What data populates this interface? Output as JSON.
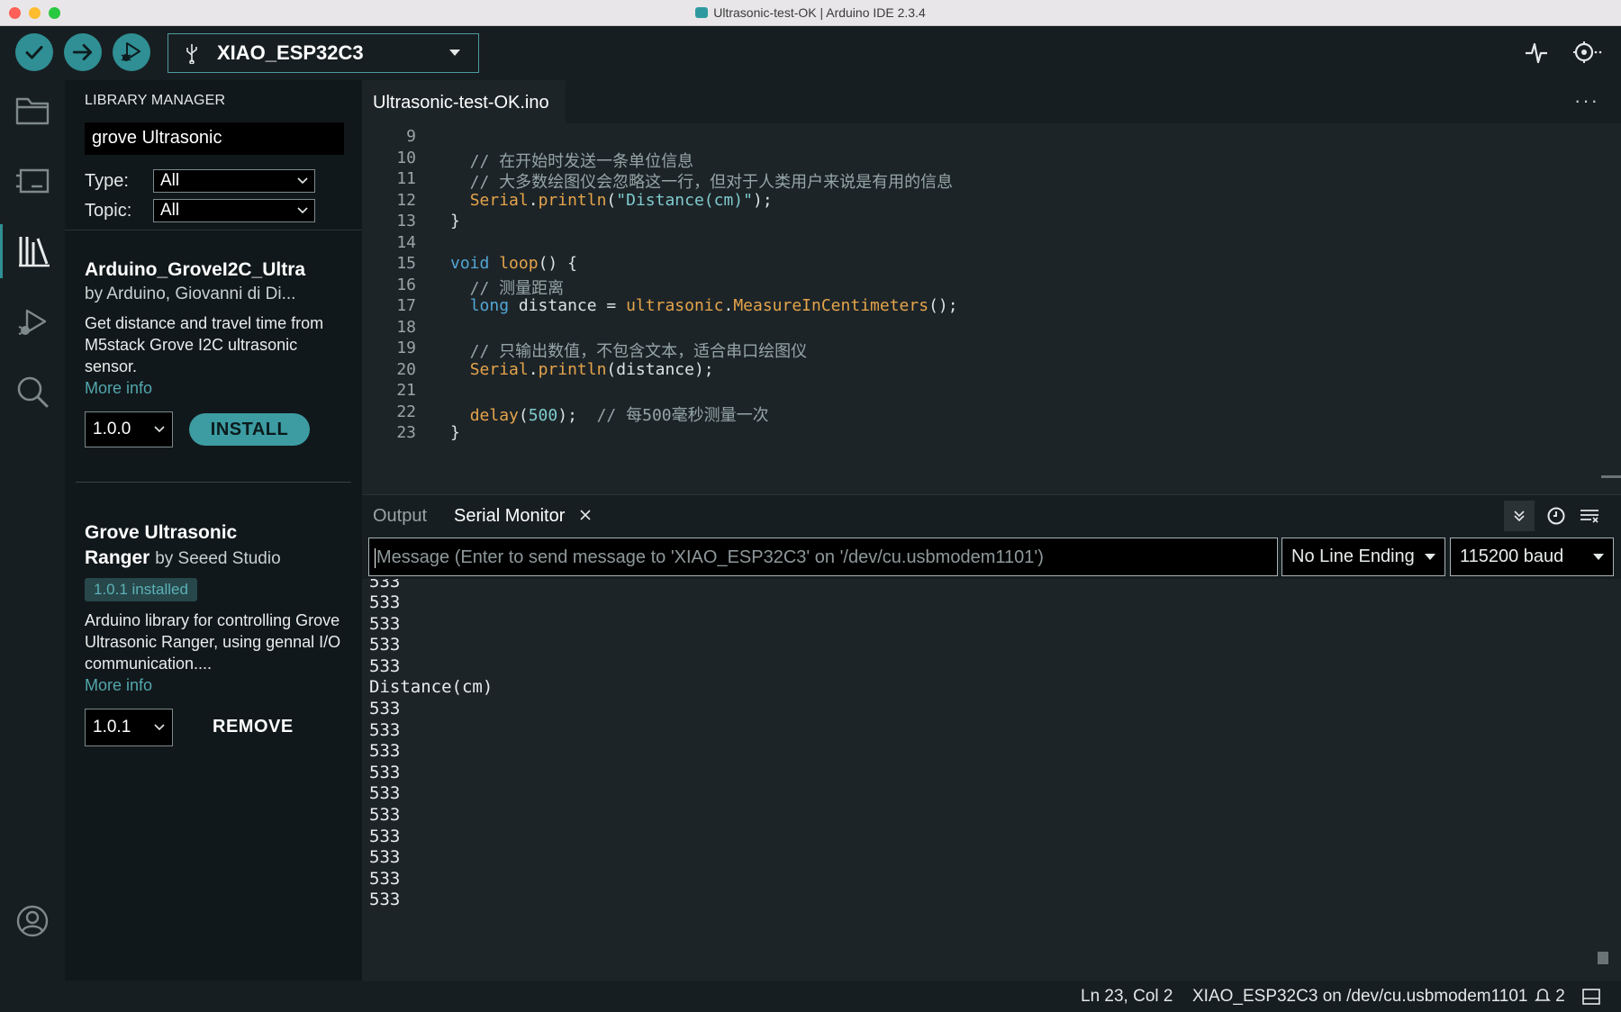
{
  "window": {
    "title": "Ultrasonic-test-OK | Arduino IDE 2.3.4"
  },
  "toolbar": {
    "verify_icon": "check-icon",
    "upload_icon": "arrow-right-icon",
    "debug_icon": "debug-play-icon",
    "board_name": "XIAO_ESP32C3",
    "serial_plotter_icon": "pulse-icon",
    "serial_monitor_icon": "serial-monitor-icon"
  },
  "activity_bar": [
    "folder-icon",
    "board-manager-icon",
    "library-icon",
    "debug-icon",
    "search-icon",
    "account-icon"
  ],
  "library_manager": {
    "title": "LIBRARY MANAGER",
    "search_value": "grove Ultrasonic",
    "type_label": "Type:",
    "type_value": "All",
    "topic_label": "Topic:",
    "topic_value": "All",
    "items": [
      {
        "name": "Arduino_GroveI2C_Ultra",
        "author": "by Arduino, Giovanni di Di...",
        "description": "Get distance and travel time from M5stack Grove I2C ultrasonic sensor.",
        "more_info": "More info",
        "version": "1.0.0",
        "action": "INSTALL"
      },
      {
        "name_line1": "Grove Ultrasonic",
        "name_line2": "Ranger",
        "author": "by Seeed Studio",
        "installed_badge": "1.0.1 installed",
        "description": "Arduino library for controlling Grove Ultrasonic Ranger, using gennal I/O communication....",
        "more_info": "More info",
        "version": "1.0.1",
        "action": "REMOVE"
      }
    ]
  },
  "editor": {
    "tab_name": "Ultrasonic-test-OK.ino",
    "more_label": "···",
    "lines": [
      {
        "n": "9",
        "parts": []
      },
      {
        "n": "10",
        "parts": [
          {
            "t": "  // 在开始时发送一条单位信息",
            "c": "c-comment"
          }
        ]
      },
      {
        "n": "11",
        "parts": [
          {
            "t": "  // 大多数绘图仪会忽略这一行，但对于人类用户来说是有用的信息",
            "c": "c-comment"
          }
        ]
      },
      {
        "n": "12",
        "parts": [
          {
            "t": "  ",
            "c": ""
          },
          {
            "t": "Serial",
            "c": "c-fn"
          },
          {
            "t": ".",
            "c": ""
          },
          {
            "t": "println",
            "c": "c-fn"
          },
          {
            "t": "(",
            "c": ""
          },
          {
            "t": "\"Distance(cm)\"",
            "c": "c-str"
          },
          {
            "t": ");",
            "c": ""
          }
        ]
      },
      {
        "n": "13",
        "parts": [
          {
            "t": "}",
            "c": ""
          }
        ]
      },
      {
        "n": "14",
        "parts": []
      },
      {
        "n": "15",
        "parts": [
          {
            "t": "void",
            "c": "c-kw"
          },
          {
            "t": " ",
            "c": ""
          },
          {
            "t": "loop",
            "c": "c-fn"
          },
          {
            "t": "() {",
            "c": ""
          }
        ]
      },
      {
        "n": "16",
        "parts": [
          {
            "t": "  // 测量距离",
            "c": "c-comment"
          }
        ]
      },
      {
        "n": "17",
        "parts": [
          {
            "t": "  ",
            "c": ""
          },
          {
            "t": "long",
            "c": "c-kw"
          },
          {
            "t": " distance = ",
            "c": ""
          },
          {
            "t": "ultrasonic",
            "c": "c-fn"
          },
          {
            "t": ".",
            "c": ""
          },
          {
            "t": "MeasureInCentimeters",
            "c": "c-fn"
          },
          {
            "t": "();",
            "c": ""
          }
        ]
      },
      {
        "n": "18",
        "parts": []
      },
      {
        "n": "19",
        "parts": [
          {
            "t": "  // 只输出数值，不包含文本，适合串口绘图仪",
            "c": "c-comment"
          }
        ]
      },
      {
        "n": "20",
        "parts": [
          {
            "t": "  ",
            "c": ""
          },
          {
            "t": "Serial",
            "c": "c-fn"
          },
          {
            "t": ".",
            "c": ""
          },
          {
            "t": "println",
            "c": "c-fn"
          },
          {
            "t": "(distance);",
            "c": ""
          }
        ]
      },
      {
        "n": "21",
        "parts": []
      },
      {
        "n": "22",
        "parts": [
          {
            "t": "  ",
            "c": ""
          },
          {
            "t": "delay",
            "c": "c-fn"
          },
          {
            "t": "(",
            "c": ""
          },
          {
            "t": "500",
            "c": "c-num"
          },
          {
            "t": ");  ",
            "c": ""
          },
          {
            "t": "// 每500毫秒测量一次",
            "c": "c-comment"
          }
        ]
      },
      {
        "n": "23",
        "parts": [
          {
            "t": "}",
            "c": ""
          }
        ]
      }
    ]
  },
  "panel": {
    "output_tab": "Output",
    "serial_tab": "Serial Monitor",
    "message_placeholder": "Message (Enter to send message to 'XIAO_ESP32C3' on '/dev/cu.usbmodem1101')",
    "line_ending": "No Line Ending",
    "baud": "115200 baud",
    "serial_lines": [
      "533",
      "533",
      "533",
      "533",
      "Distance(cm)",
      "533",
      "533",
      "533",
      "533",
      "533",
      "533",
      "533",
      "533",
      "533",
      "533"
    ]
  },
  "status": {
    "position": "Ln 23, Col 2",
    "board": "XIAO_ESP32C3 on /dev/cu.usbmodem1101",
    "notifications": "2"
  }
}
